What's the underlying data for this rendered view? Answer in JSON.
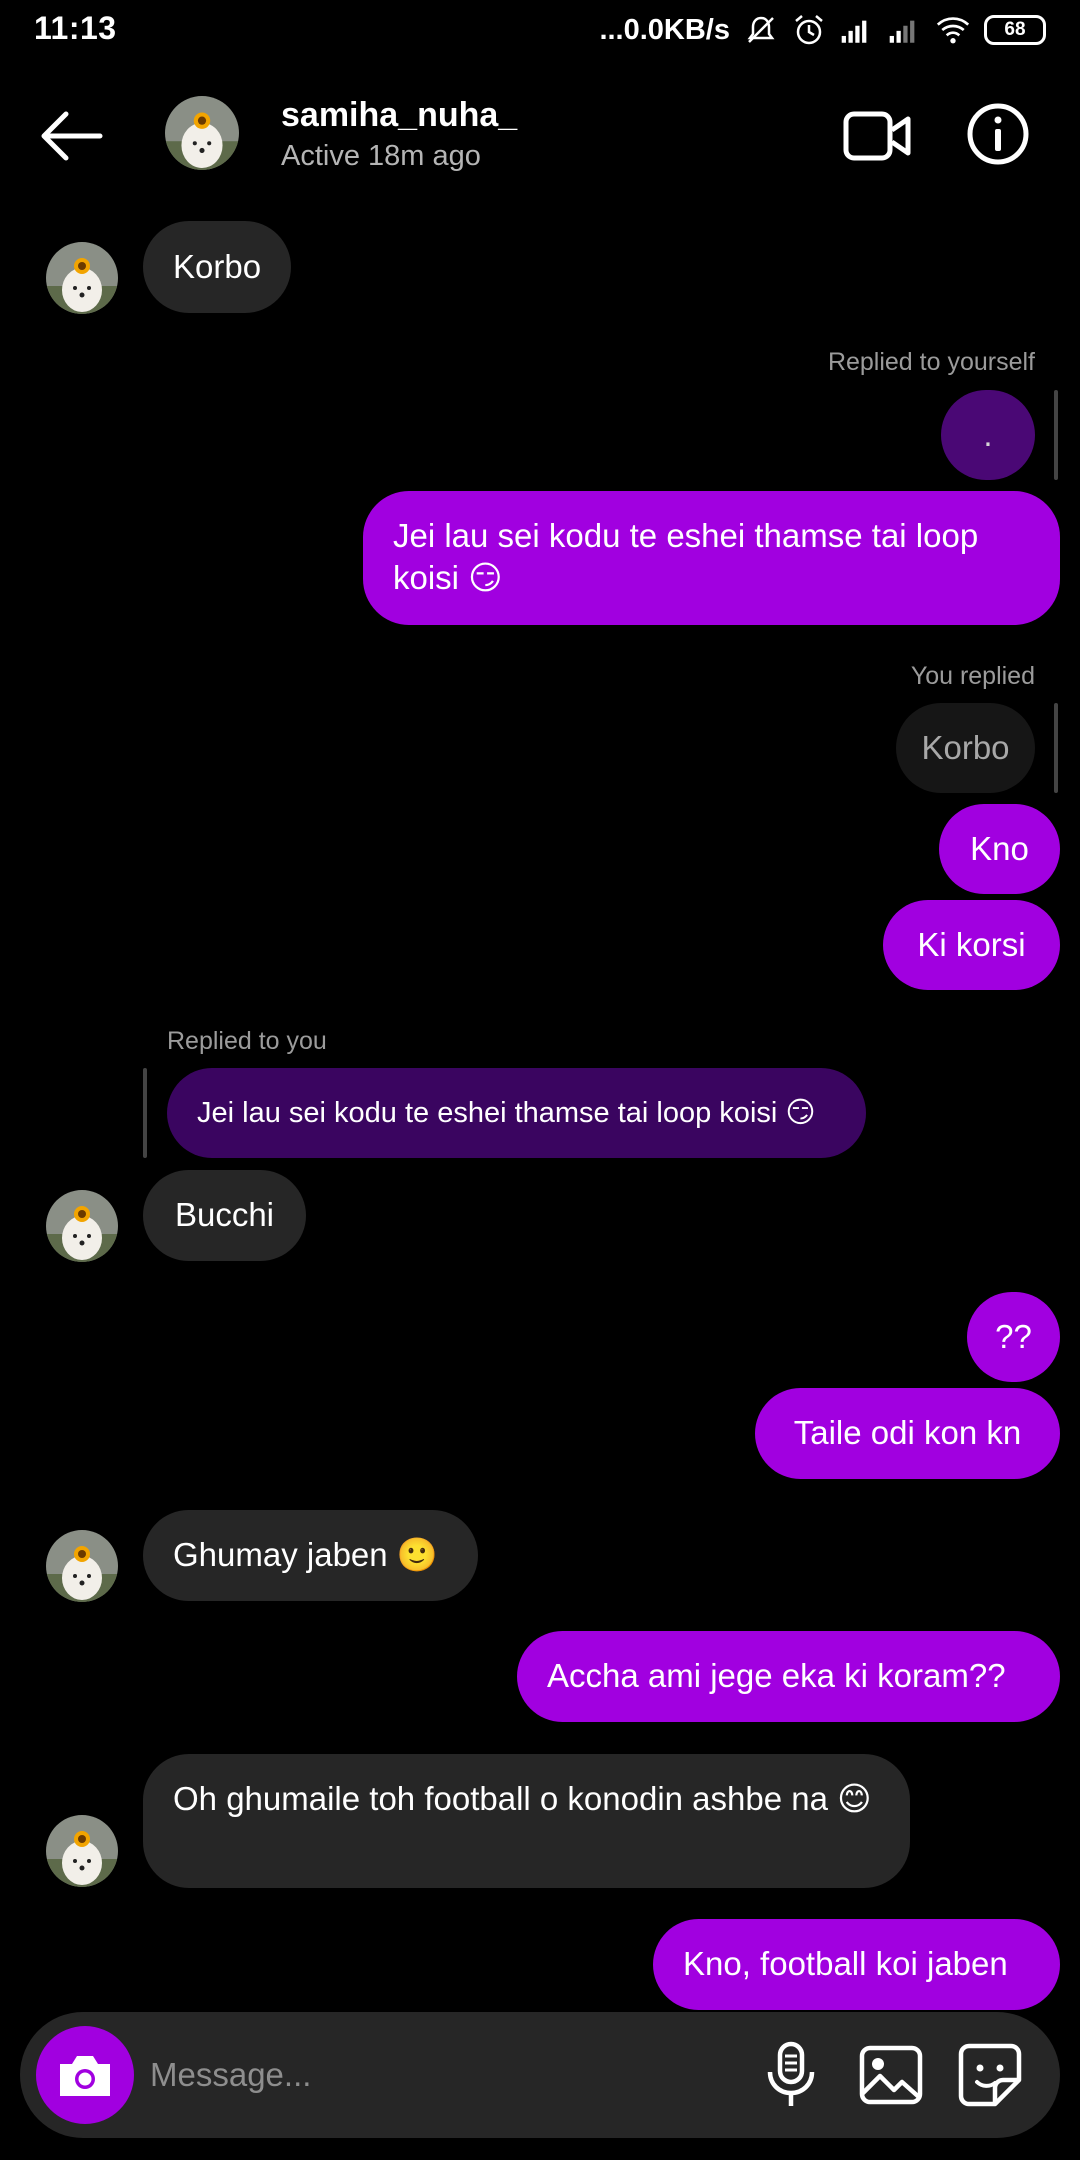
{
  "status_bar": {
    "time": "11:13",
    "net_speed": "...0.0KB/s",
    "battery": "68",
    "icons": [
      "mute-icon",
      "alarm-icon",
      "signal-icon",
      "signal-icon",
      "wifi-icon",
      "battery-icon"
    ]
  },
  "header": {
    "username": "samiha_nuha_",
    "status": "Active 18m ago",
    "icons": [
      "back-arrow-icon",
      "video-call-icon",
      "info-icon"
    ]
  },
  "messages": {
    "m1": "Korbo",
    "r1_label": "Replied to yourself",
    "r1_quote": ".",
    "m2": "Jei lau sei kodu te eshei thamse tai loop koisi 😏",
    "r2_label": "You replied",
    "r2_quote": "Korbo",
    "m3": "Kno",
    "m4": "Ki korsi",
    "r3_label": "Replied to you",
    "r3_quote": "Jei lau sei kodu te eshei thamse tai loop koisi 😏",
    "m5": "Bucchi",
    "m6": "??",
    "m7": "Taile odi kon kn",
    "m8": "Ghumay jaben 🙂",
    "m9": "Accha ami jege eka ki koram??",
    "m10": "Oh ghumaile toh football o konodin ashbe na 😊",
    "m11": "Kno, football koi jaben"
  },
  "composer": {
    "placeholder": "Message...",
    "icons": [
      "camera-icon",
      "microphone-icon",
      "gallery-icon",
      "sticker-icon"
    ]
  },
  "colors": {
    "outgoing": "#a100e0",
    "incoming": "#262626",
    "background": "#000000"
  }
}
